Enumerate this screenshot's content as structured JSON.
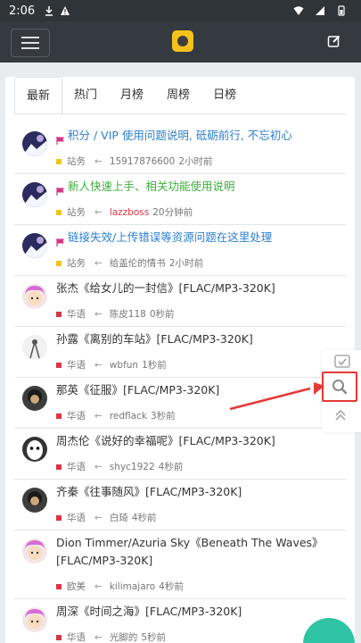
{
  "status": {
    "time": "2:06"
  },
  "tabs": [
    "最新",
    "热门",
    "月榜",
    "周榜",
    "日榜"
  ],
  "items": [
    {
      "title": "积分 / VIP 使用问题说明, 砥砺前行, 不忘初心",
      "color": "blue",
      "flag": true,
      "category": "站务",
      "category_color": "#f0c419",
      "user": "15917876600",
      "user_red": false,
      "time": "2小时前",
      "avatar": "anime"
    },
    {
      "title": "新人快速上手、相关功能使用说明",
      "color": "green",
      "flag": true,
      "category": "站务",
      "category_color": "#f0c419",
      "user": "lazzboss",
      "user_red": true,
      "time": "20分钟前",
      "avatar": "anime"
    },
    {
      "title": "链接失效/上传错误等资源问题在这里处理",
      "color": "blue",
      "flag": true,
      "category": "站务",
      "category_color": "#f0c419",
      "user": "给盖伦的情书",
      "user_red": false,
      "time": "2小时前",
      "avatar": "anime"
    },
    {
      "title": "张杰《给女儿的一封信》[FLAC/MP3-320K]",
      "color": "normal",
      "flag": false,
      "category": "华语",
      "category_color": "#dc3545",
      "user": "陈皮118",
      "user_red": false,
      "time": "0秒前",
      "avatar": "pink"
    },
    {
      "title": "孙露《离别的车站》[FLAC/MP3-320K]",
      "color": "normal",
      "flag": false,
      "category": "华语",
      "category_color": "#dc3545",
      "user": "wbfun",
      "user_red": false,
      "time": "1秒前",
      "avatar": "sketch"
    },
    {
      "title": "那英《征服》[FLAC/MP3-320K]",
      "color": "normal",
      "flag": false,
      "category": "华语",
      "category_color": "#dc3545",
      "user": "redflack",
      "user_red": false,
      "time": "3秒前",
      "avatar": "dark"
    },
    {
      "title": "周杰伦《说好的幸福呢》[FLAC/MP3-320K]",
      "color": "normal",
      "flag": false,
      "category": "华语",
      "category_color": "#dc3545",
      "user": "shyc1922",
      "user_red": false,
      "time": "4秒前",
      "avatar": "mask"
    },
    {
      "title": "齐秦《往事随风》[FLAC/MP3-320K]",
      "color": "normal",
      "flag": false,
      "category": "华语",
      "category_color": "#dc3545",
      "user": "白琦",
      "user_red": false,
      "time": "4秒前",
      "avatar": "dark"
    },
    {
      "title": "Dion Timmer/Azuria Sky《Beneath The Waves》[FLAC/MP3-320K]",
      "color": "normal",
      "flag": false,
      "category": "欧美",
      "category_color": "#dc3545",
      "user": "kilimajaro",
      "user_red": false,
      "time": "4秒前",
      "avatar": "pink"
    },
    {
      "title": "周深《时间之海》[FLAC/MP3-320K]",
      "color": "normal",
      "flag": false,
      "category": "华语",
      "category_color": "#dc3545",
      "user": "光脚的",
      "user_red": false,
      "time": "5秒前",
      "avatar": "pink"
    }
  ]
}
